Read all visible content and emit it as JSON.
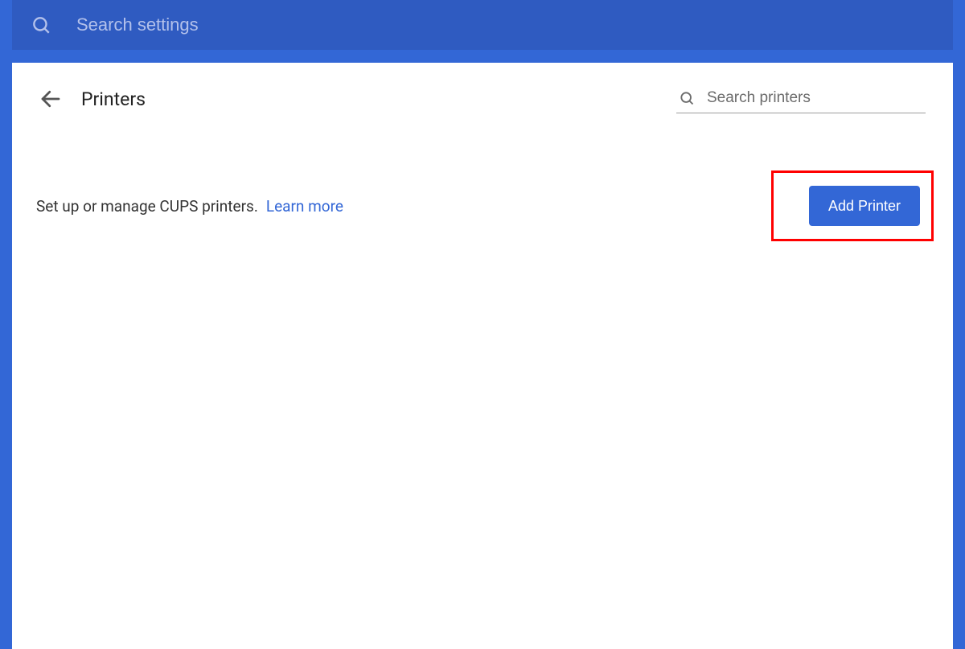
{
  "topbar": {
    "search_placeholder": "Search settings"
  },
  "page": {
    "title": "Printers",
    "search_placeholder": "Search printers"
  },
  "body": {
    "description": "Set up or manage CUPS printers.",
    "learn_more_label": "Learn more",
    "add_printer_label": "Add Printer"
  },
  "colors": {
    "brand_blue": "#3367d6",
    "topbar_blue": "#2f5bc1",
    "highlight_red": "#ff0000"
  }
}
